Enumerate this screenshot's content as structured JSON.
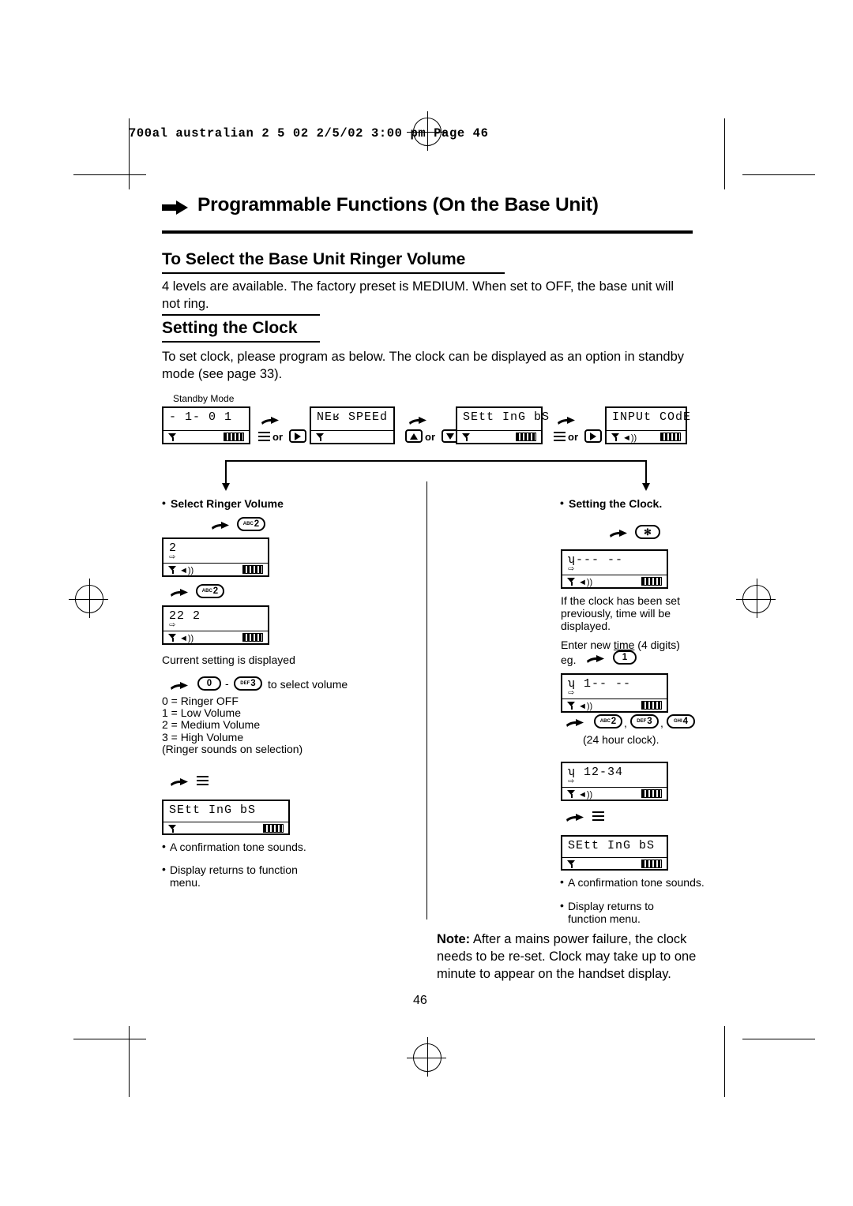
{
  "header": {
    "printer_line": "700al  australian 2 5 02  2/5/02  3:00 pm  Page 46"
  },
  "chapter": {
    "title": "Programmable Functions (On the Base Unit)",
    "arrow_icon": "right-arrow-icon"
  },
  "sections": [
    {
      "title": "To Select the Base Unit Ringer Volume",
      "body": "4 levels are available. The factory preset is MEDIUM. When set to OFF, the base unit will not ring."
    },
    {
      "title": "Setting the Clock",
      "body": "To set clock, please program as below. The clock can be displayed as an option in standby mode (see page 33)."
    }
  ],
  "flow": {
    "standby_label": "Standby Mode",
    "steps": [
      {
        "display_main": "- 1-      0 1",
        "bottom_left": "antenna",
        "battery": true
      },
      {
        "display_main": "NEʁ SPEEd",
        "bottom_left": "antenna",
        "battery": false
      },
      {
        "display_main": "SEtt InG bS",
        "bottom_left": "antenna",
        "battery": true
      },
      {
        "display_main": "INPUt COdE",
        "bottom_left": "antenna+ring",
        "battery": true
      }
    ],
    "keys": [
      {
        "label": "or",
        "left": "menu-icon",
        "right": "right-arrow-key"
      },
      {
        "label": "or",
        "left": "up-arrow-key",
        "right": "down-arrow-key"
      },
      {
        "label": "or",
        "left": "menu-icon",
        "right": "right-arrow-key"
      }
    ]
  },
  "left_column": {
    "heading": "Select Ringer Volume",
    "key1": {
      "prefix": "ABC",
      "digit": "2"
    },
    "display1": "2",
    "key2": {
      "prefix": "ABC",
      "digit": "2"
    },
    "display2": "22 2",
    "caption1": "Current setting is displayed",
    "range_keys": {
      "from_digit": "0",
      "dash": "-",
      "to_prefix": "DEF",
      "to_digit": "3",
      "caption": "to select volume"
    },
    "volume_list": [
      "0 = Ringer OFF",
      "1 = Low Volume",
      "2 = Medium Volume",
      "3 = High Volume",
      "(Ringer sounds on selection)"
    ],
    "menu_key_icon": "menu-icon",
    "display3": "SEtt InG bS",
    "confirm_lines": [
      "A confirmation tone sounds.",
      "Display returns to function menu."
    ]
  },
  "right_column": {
    "heading": "Setting the Clock.",
    "star_key": "✻",
    "display1": "ʮ--- --",
    "note1": "If the clock has been set previously, time will be displayed.",
    "note2_prefix": "Enter new ",
    "note2_underline": "time",
    "note2_suffix": " (4 digits)",
    "eg_label": "eg.",
    "eg_key": "1",
    "display2": "ʮ 1-- --",
    "keys_row": [
      {
        "prefix": "ABC",
        "digit": "2"
      },
      {
        "prefix": "DEF",
        "digit": "3"
      },
      {
        "prefix": "GHI",
        "digit": "4"
      }
    ],
    "clock_caption": "(24 hour clock).",
    "display3": "ʮ 12-34",
    "menu_key_icon": "menu-icon",
    "display4": "SEtt InG bS",
    "confirm_lines": [
      "A confirmation tone sounds.",
      "Display returns to function menu."
    ],
    "note": {
      "bold": "Note:",
      "text": " After a mains power failure, the clock needs to be re-set. Clock may take up to one minute to appear on the handset display."
    }
  },
  "page_number": "46"
}
